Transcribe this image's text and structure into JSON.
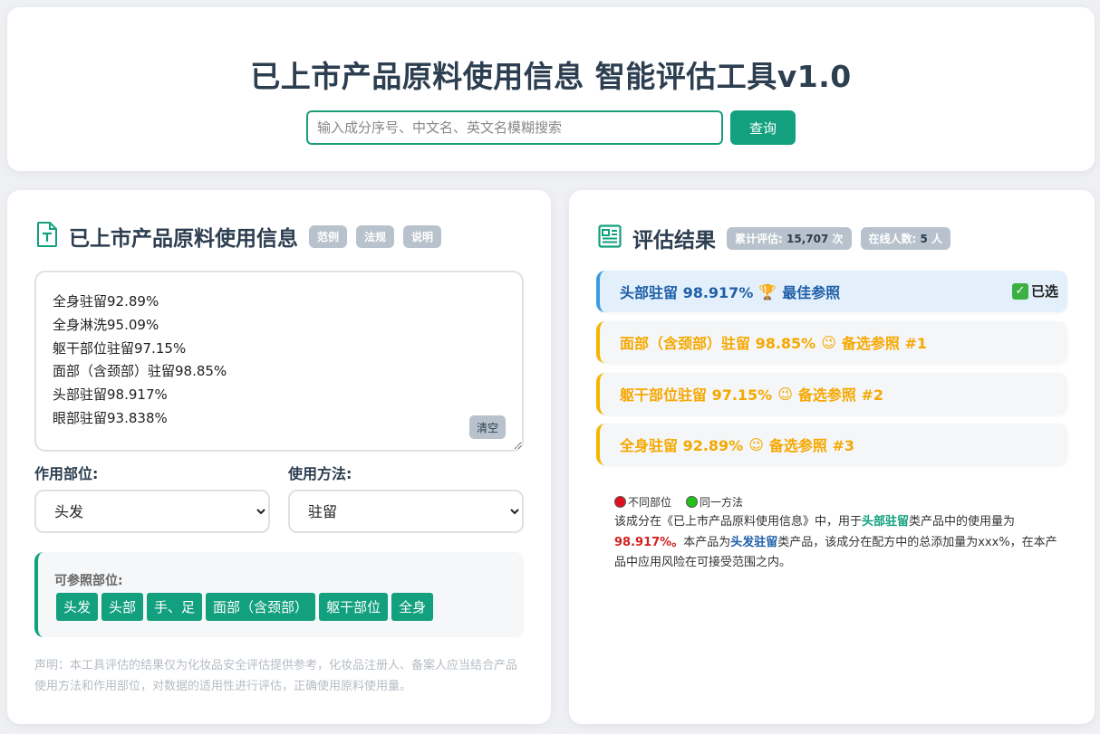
{
  "header": {
    "title": "已上市产品原料使用信息 智能评估工具v1.0",
    "search_placeholder": "输入成分序号、中文名、英文名模糊搜索",
    "search_button": "查询"
  },
  "left_panel": {
    "title": "已上市产品原料使用信息",
    "chips": [
      "范例",
      "法规",
      "说明"
    ],
    "textarea_value": "全身驻留92.89%\n全身淋洗95.09%\n躯干部位驻留97.15%\n面部（含颈部）驻留98.85%\n头部驻留98.917%\n眼部驻留93.838%",
    "clear_button": "清空",
    "site_label": "作用部位:",
    "site_selected": "头发",
    "method_label": "使用方法:",
    "method_selected": "驻留",
    "ref_label": "可参照部位:",
    "ref_tags": [
      "头发",
      "头部",
      "手、足",
      "面部（含颈部）",
      "躯干部位",
      "全身"
    ],
    "disclaimer": "声明：本工具评估的结果仅为化妆品安全评估提供参考，化妆品注册人、备案人应当结合产品使用方法和作用部位，对数据的适用性进行评估，正确使用原料使用量。"
  },
  "right_panel": {
    "title": "评估结果",
    "stat_total_label": "累计评估:",
    "stat_total_value": "15,707",
    "stat_total_unit": "次",
    "stat_online_label": "在线人数:",
    "stat_online_value": "5",
    "stat_online_unit": "人",
    "results": [
      {
        "text": "头部驻留 98.917%",
        "icon": "🏆",
        "tag": "最佳参照",
        "selected": "已选"
      },
      {
        "text": "面部（含颈部）驻留 98.85%",
        "icon": "😉",
        "tag": "备选参照 #1"
      },
      {
        "text": "躯干部位驻留 97.15%",
        "icon": "😉",
        "tag": "备选参照 #2"
      },
      {
        "text": "全身驻留 92.89%",
        "icon": "😉",
        "tag": "备选参照 #3"
      }
    ],
    "legend_diff": "不同部位",
    "legend_same": "同一方法",
    "explain": {
      "p1": "该成分在《已上市产品原料使用信息》中，用于",
      "hl1": "头部驻留",
      "p2": "类产品中的使用量为",
      "hl2": "98.917%。",
      "p3": "本产品为",
      "hl3": "头发驻留",
      "p4": "类产品，该成分在配方中的总添加量为xxx%，在本产品中应用风险在可接受范围之内。"
    }
  },
  "colors": {
    "accent": "#12a07e",
    "best_blue": "#1f5fa8",
    "alt_orange": "#f5a800",
    "legend_red": "#e0101e",
    "legend_green": "#22c21a"
  }
}
